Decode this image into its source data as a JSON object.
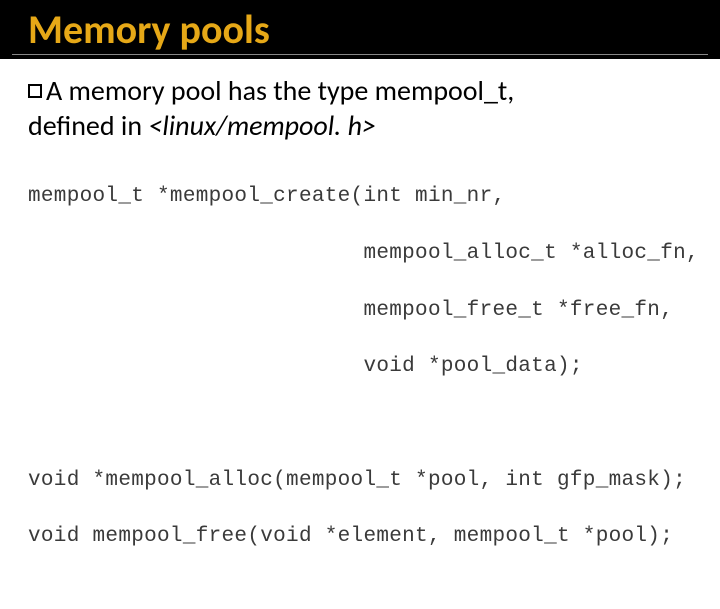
{
  "title": "Memory pools",
  "bullet": {
    "lead": "A",
    "text1": " memory pool has the type mempool_t,",
    "text2_pre": "defined in ",
    "text2_italic": "<linux/mempool. h>"
  },
  "code": {
    "l1": "mempool_t *mempool_create(int min_nr,",
    "l2": "                          mempool_alloc_t *alloc_fn,",
    "l3": "                          mempool_free_t *free_fn,",
    "l4": "                          void *pool_data);",
    "l5": "",
    "l6": "",
    "l7": "void *mempool_alloc(mempool_t *pool, int gfp_mask);",
    "l8": "void mempool_free(void *element, mempool_t *pool);"
  }
}
